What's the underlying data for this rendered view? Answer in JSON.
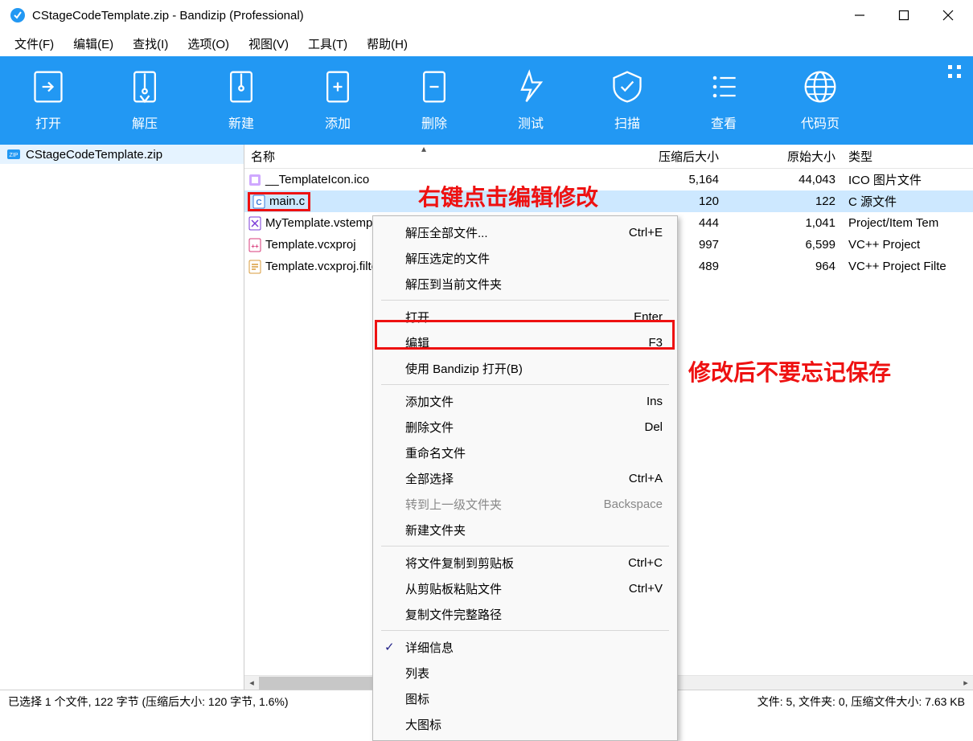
{
  "window": {
    "title": "CStageCodeTemplate.zip - Bandizip (Professional)"
  },
  "menubar": [
    {
      "label": "文件(F)"
    },
    {
      "label": "编辑(E)"
    },
    {
      "label": "查找(I)"
    },
    {
      "label": "选项(O)"
    },
    {
      "label": "视图(V)"
    },
    {
      "label": "工具(T)"
    },
    {
      "label": "帮助(H)"
    }
  ],
  "toolbar": [
    {
      "label": "打开"
    },
    {
      "label": "解压"
    },
    {
      "label": "新建"
    },
    {
      "label": "添加"
    },
    {
      "label": "删除"
    },
    {
      "label": "测试"
    },
    {
      "label": "扫描"
    },
    {
      "label": "查看"
    },
    {
      "label": "代码页"
    }
  ],
  "tree": {
    "root": "CStageCodeTemplate.zip"
  },
  "columns": {
    "name": "名称",
    "csize": "压缩后大小",
    "osize": "原始大小",
    "type": "类型"
  },
  "files": [
    {
      "name": "__TemplateIcon.ico",
      "csize": "5,164",
      "osize": "44,043",
      "type": "ICO 图片文件"
    },
    {
      "name": "main.c",
      "csize": "120",
      "osize": "122",
      "type": "C 源文件"
    },
    {
      "name": "MyTemplate.vstemplate",
      "csize": "444",
      "osize": "1,041",
      "type": "Project/Item Tem"
    },
    {
      "name": "Template.vcxproj",
      "csize": "997",
      "osize": "6,599",
      "type": "VC++ Project"
    },
    {
      "name": "Template.vcxproj.filters",
      "csize": "489",
      "osize": "964",
      "type": "VC++ Project Filte"
    }
  ],
  "annotations": {
    "a1": "右键点击编辑修改",
    "a2": "修改后不要忘记保存"
  },
  "context_menu": [
    {
      "label": "解压全部文件...",
      "hotkey": "Ctrl+E"
    },
    {
      "label": "解压选定的文件"
    },
    {
      "label": "解压到当前文件夹"
    },
    {
      "sep": true
    },
    {
      "label": "打开",
      "hotkey": "Enter"
    },
    {
      "label": "编辑",
      "hotkey": "F3"
    },
    {
      "label": "使用 Bandizip 打开(B)"
    },
    {
      "sep": true
    },
    {
      "label": "添加文件",
      "hotkey": "Ins"
    },
    {
      "label": "删除文件",
      "hotkey": "Del"
    },
    {
      "label": "重命名文件"
    },
    {
      "label": "全部选择",
      "hotkey": "Ctrl+A"
    },
    {
      "label": "转到上一级文件夹",
      "hotkey": "Backspace",
      "disabled": true
    },
    {
      "label": "新建文件夹"
    },
    {
      "sep": true
    },
    {
      "label": "将文件复制到剪贴板",
      "hotkey": "Ctrl+C"
    },
    {
      "label": "从剪贴板粘贴文件",
      "hotkey": "Ctrl+V"
    },
    {
      "label": "复制文件完整路径"
    },
    {
      "sep": true
    },
    {
      "label": "详细信息",
      "check": true
    },
    {
      "label": "列表"
    },
    {
      "label": "图标"
    },
    {
      "label": "大图标"
    }
  ],
  "statusbar": {
    "left": "已选择 1 个文件, 122 字节 (压缩后大小: 120 字节, 1.6%)",
    "right": "文件: 5, 文件夹: 0, 压缩文件大小: 7.63 KB"
  }
}
